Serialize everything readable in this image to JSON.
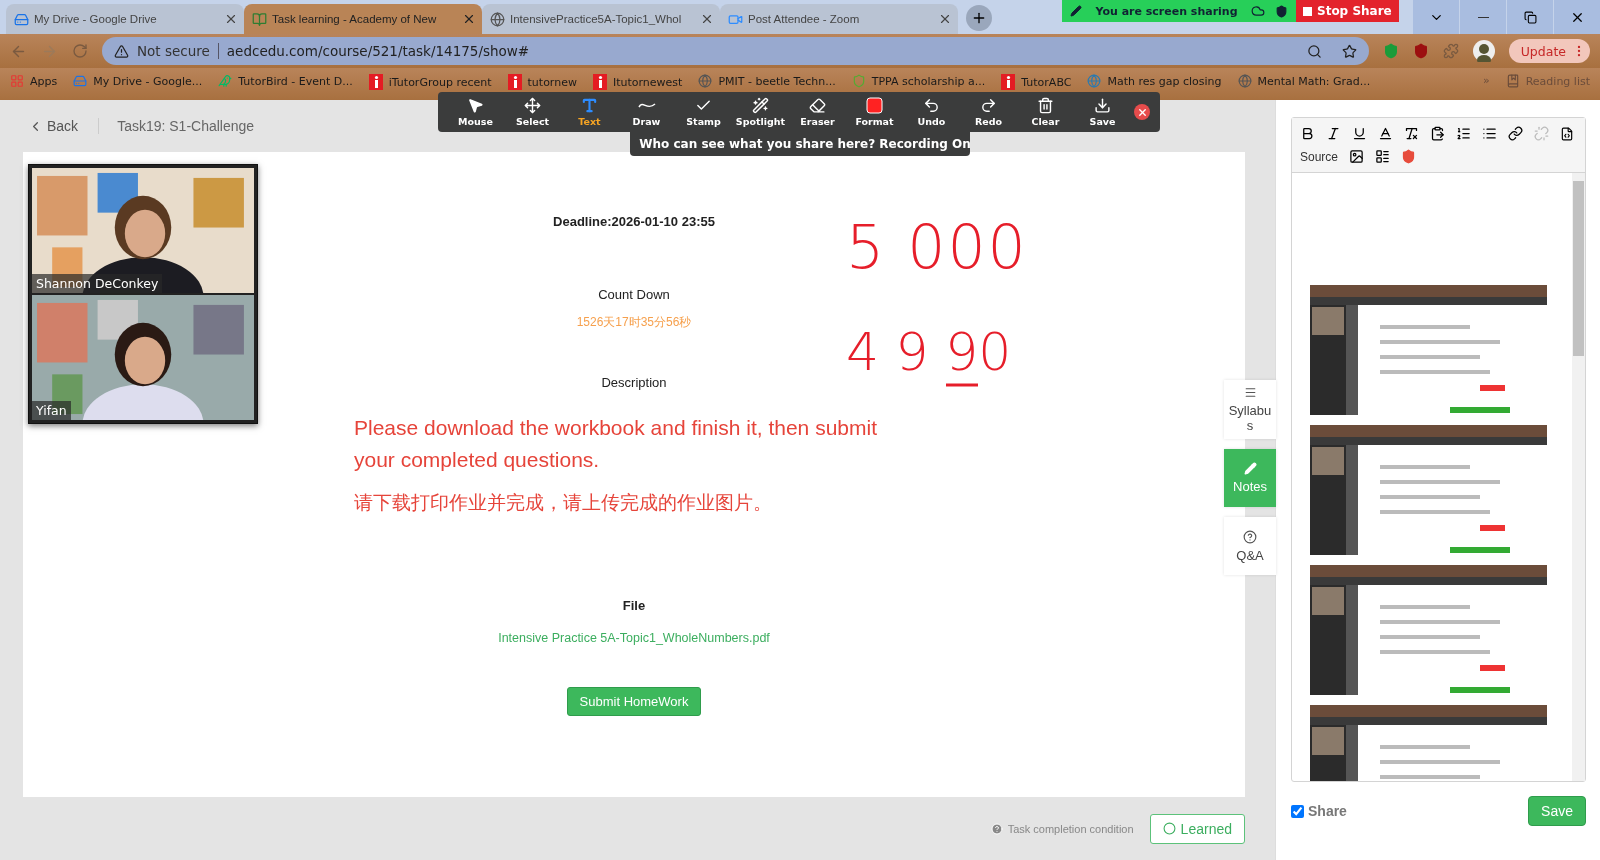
{
  "browser": {
    "tabs": [
      {
        "title": "My Drive - Google Drive",
        "kind": "drive",
        "selected": false
      },
      {
        "title": "Task learning - Academy of New",
        "kind": "book",
        "selected": true
      },
      {
        "title": "IntensivePractice5A-Topic1_Whol",
        "kind": "globe",
        "selected": false
      },
      {
        "title": "Post Attendee - Zoom",
        "kind": "video",
        "selected": false
      }
    ],
    "security": "Not secure",
    "url": "aedcedu.com/course/521/task/14175/show#",
    "update": "Update",
    "bookmarks": [
      {
        "label": "Apps",
        "kind": "apps"
      },
      {
        "label": "My Drive - Google...",
        "kind": "drive"
      },
      {
        "label": "TutorBird - Event D...",
        "kind": "bird"
      },
      {
        "label": "iTutorGroup recent",
        "kind": "itutor"
      },
      {
        "label": "tutornew",
        "kind": "itutor"
      },
      {
        "label": "Itutornewest",
        "kind": "itutor"
      },
      {
        "label": "PMIT - beetle Techn...",
        "kind": "globe"
      },
      {
        "label": "TPPA scholarship a...",
        "kind": "crest"
      },
      {
        "label": "TutorABC",
        "kind": "itutor"
      },
      {
        "label": "Math res gap closing",
        "kind": "world"
      },
      {
        "label": "Mental Math: Grad...",
        "kind": "globe"
      }
    ],
    "overflow": "»",
    "reading_list": "Reading list"
  },
  "share_bar": {
    "status": "You are screen sharing",
    "stop": "Stop Share"
  },
  "annotation_toolbar": {
    "tools": [
      {
        "label": "Mouse",
        "kind": "mouse",
        "selected": false
      },
      {
        "label": "Select",
        "kind": "select",
        "selected": false
      },
      {
        "label": "Text",
        "kind": "text",
        "selected": true
      },
      {
        "label": "Draw",
        "kind": "draw",
        "selected": false
      },
      {
        "label": "Stamp",
        "kind": "stamp",
        "selected": false
      },
      {
        "label": "Spotlight",
        "kind": "spotlight",
        "selected": false
      },
      {
        "label": "Eraser",
        "kind": "eraser",
        "selected": false
      },
      {
        "label": "Format",
        "kind": "format",
        "selected": false
      },
      {
        "label": "Undo",
        "kind": "undo",
        "selected": false
      },
      {
        "label": "Redo",
        "kind": "redo",
        "selected": false
      },
      {
        "label": "Clear",
        "kind": "clear",
        "selected": false
      },
      {
        "label": "Save",
        "kind": "save",
        "selected": false
      }
    ],
    "notice": "Who can see what you share here? Recording On"
  },
  "header": {
    "back": "Back",
    "title": "Task19:  S1-Challenge"
  },
  "videos": [
    {
      "name": "Shannon DeConkey"
    },
    {
      "name": "Yifan"
    }
  ],
  "task": {
    "deadline": "Deadline:2026-01-10 23:55",
    "countdown_label": "Count Down",
    "countdown": "1526天17时35分56秒",
    "description_label": "Description",
    "description": "Please download the workbook and finish it, then submit your completed questions.",
    "description_zh": "请下载打印作业并完成，请上传完成的作业图片。",
    "file_label": "File",
    "file": "Intensive Practice 5A-Topic1_WholeNumbers.pdf",
    "submit": "Submit HomeWork"
  },
  "annotations": [
    {
      "text": "5 000",
      "underline": false
    },
    {
      "text": "4 9 90",
      "underline": true
    }
  ],
  "side_tabs": [
    {
      "label": "Syllabus",
      "kind": "lines",
      "selected": false
    },
    {
      "label": "Notes",
      "kind": "pencil",
      "selected": true
    },
    {
      "label": "Q&A",
      "kind": "question",
      "selected": false
    }
  ],
  "footer": {
    "condition": "Task completion condition",
    "learned": "Learned"
  },
  "notes": {
    "source": "Source",
    "share": {
      "label": "Share",
      "checked": true
    },
    "save": "Save"
  }
}
